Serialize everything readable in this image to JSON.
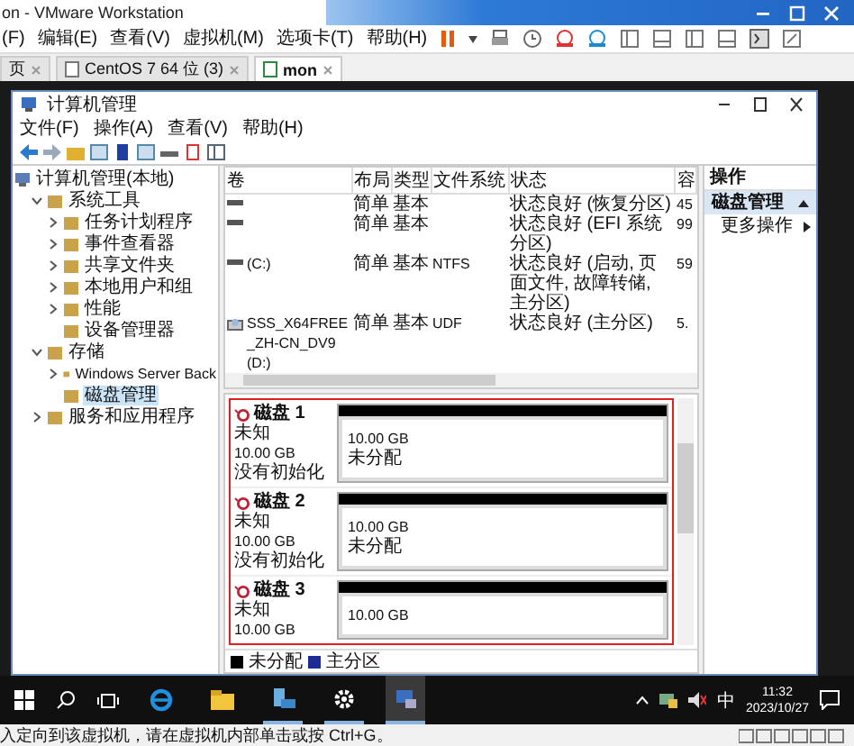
{
  "vmware": {
    "title": "on - VMware Workstation",
    "menu": [
      "(F)",
      "编辑(E)",
      "查看(V)",
      "虚拟机(M)",
      "选项卡(T)",
      "帮助(H)"
    ],
    "tabs": [
      {
        "label": "页",
        "selected": false
      },
      {
        "label": "CentOS 7 64 位 (3)",
        "selected": false
      },
      {
        "label": "mon",
        "selected": true
      }
    ],
    "status_text": "入定向到该虚拟机，请在虚拟机内部单击或按 Ctrl+G。"
  },
  "window": {
    "title": "计算机管理",
    "menu": [
      "文件(F)",
      "操作(A)",
      "查看(V)",
      "帮助(H)"
    ]
  },
  "tree": [
    {
      "label": "计算机管理(本地)",
      "kind": "root",
      "selected": false,
      "children": [
        {
          "label": "系统工具",
          "kind": "node",
          "expanded": true,
          "selected": false,
          "children": [
            {
              "label": "任务计划程序",
              "kind": "node",
              "expanded": false,
              "selected": false
            },
            {
              "label": "事件查看器",
              "kind": "node",
              "expanded": false,
              "selected": false
            },
            {
              "label": "共享文件夹",
              "kind": "node",
              "expanded": false,
              "selected": false
            },
            {
              "label": "本地用户和组",
              "kind": "node",
              "expanded": false,
              "selected": false
            },
            {
              "label": "性能",
              "kind": "node",
              "expanded": false,
              "selected": false
            },
            {
              "label": "设备管理器",
              "kind": "leaf",
              "selected": false
            }
          ]
        },
        {
          "label": "存储",
          "kind": "node",
          "expanded": true,
          "selected": false,
          "children": [
            {
              "label": "Windows Server Back",
              "kind": "node",
              "expanded": false,
              "selected": false
            },
            {
              "label": "磁盘管理",
              "kind": "leaf",
              "selected": true
            }
          ]
        },
        {
          "label": "服务和应用程序",
          "kind": "node",
          "expanded": false,
          "selected": false
        }
      ]
    }
  ],
  "volumes": {
    "columns": [
      "卷",
      "布局",
      "类型",
      "文件系统",
      "状态",
      "容"
    ],
    "rows": [
      {
        "kind": "disk",
        "layout": "简单",
        "type": "基本",
        "status": "状态良好 (恢复分区)",
        "capacity": "45"
      },
      {
        "kind": "disk",
        "layout": "简单",
        "type": "基本",
        "status": "状态良好 (EFI 系统分区)",
        "capacity": "99"
      },
      {
        "kind": "disk",
        "volume": "(C:)",
        "layout": "简单",
        "type": "基本",
        "fs": "NTFS",
        "status": "状态良好 (启动, 页面文件, 故障转储, 主分区)",
        "capacity": "59"
      },
      {
        "kind": "disc",
        "volume": "SSS_X64FREE_ZH-CN_DV9 (D:)",
        "layout": "简单",
        "type": "基本",
        "fs": "UDF",
        "status": "状态良好 (主分区)",
        "capacity": "5."
      }
    ]
  },
  "disks": [
    {
      "name": "磁盘 1",
      "type": "未知",
      "size": "10.00 GB",
      "state": "没有初始化",
      "partition": {
        "size": "10.00 GB",
        "label": "未分配"
      }
    },
    {
      "name": "磁盘 2",
      "type": "未知",
      "size": "10.00 GB",
      "state": "没有初始化",
      "partition": {
        "size": "10.00 GB",
        "label": "未分配"
      }
    },
    {
      "name": "磁盘 3",
      "type": "未知",
      "size": "10.00 GB",
      "partition": {
        "size": "10.00 GB"
      }
    }
  ],
  "legend": [
    {
      "label": "未分配",
      "color": "#000000"
    },
    {
      "label": "主分区",
      "color": "#1c2c94"
    }
  ],
  "actions": {
    "title": "操作",
    "section": "磁盘管理",
    "items": [
      "更多操作"
    ]
  },
  "taskbar": {
    "apps": [
      {
        "kind": "ie",
        "running": false,
        "selected": false
      },
      {
        "kind": "folder",
        "running": false,
        "selected": false
      },
      {
        "kind": "server",
        "running": true,
        "selected": false
      },
      {
        "kind": "gear",
        "running": true,
        "selected": false
      },
      {
        "kind": "computer",
        "running": true,
        "selected": true
      }
    ],
    "ime": "中",
    "time": "11:32",
    "date": "2023/10/27"
  }
}
